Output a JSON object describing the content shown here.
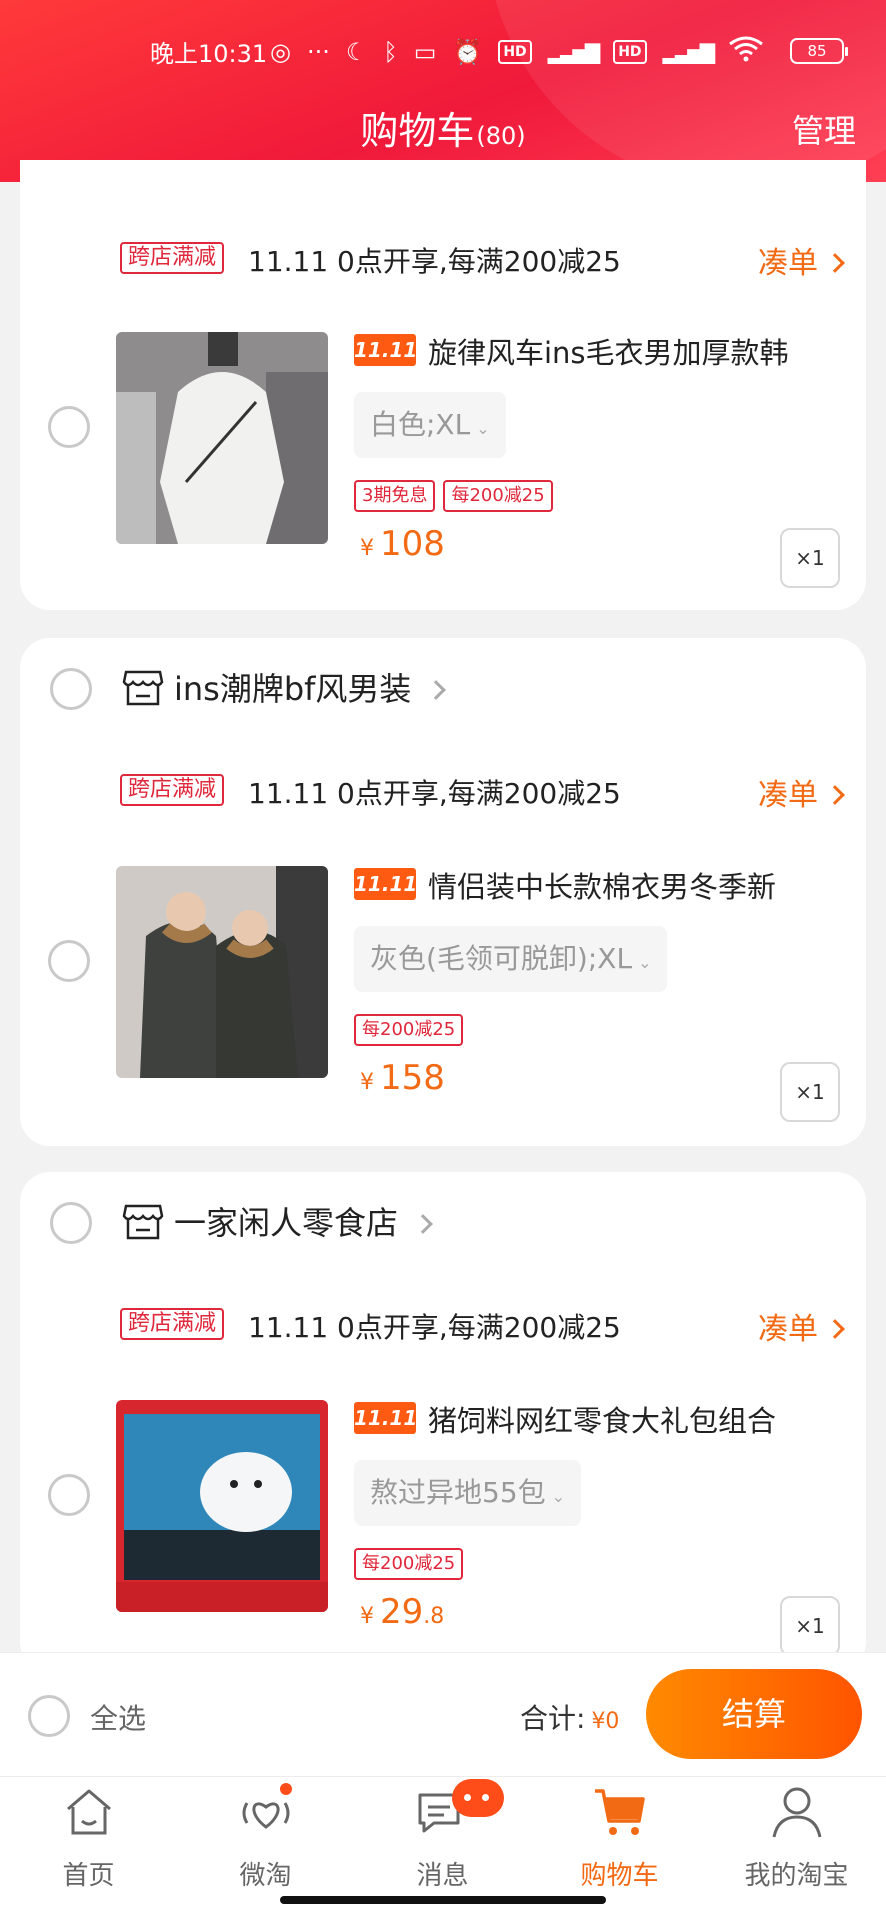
{
  "status_bar": {
    "time": "晚上10:31",
    "more": "···",
    "hd1": "HD",
    "hd2": "HD",
    "battery": "85"
  },
  "header": {
    "title": "购物车",
    "count": "(80)",
    "manage": "管理"
  },
  "shops": [
    {
      "name": "",
      "promo": {
        "tag": "跨店满减",
        "text": "11.11 0点开享,每满200减25",
        "link": "凑单"
      },
      "item": {
        "badge": "11.11",
        "name": "旋律风车ins毛衣男加厚款韩",
        "sku": "白色;XL",
        "tags": [
          "3期免息",
          "每200减25"
        ],
        "currency": "¥",
        "price": "108",
        "price_decimal": "",
        "qty": "×1"
      }
    },
    {
      "name": "ins潮牌bf风男装",
      "promo": {
        "tag": "跨店满减",
        "text": "11.11 0点开享,每满200减25",
        "link": "凑单"
      },
      "item": {
        "badge": "11.11",
        "name": "情侣装中长款棉衣男冬季新",
        "sku": "灰色(毛领可脱卸);XL",
        "tags": [
          "每200减25"
        ],
        "currency": "¥",
        "price": "158",
        "price_decimal": "",
        "qty": "×1"
      }
    },
    {
      "name": "一家闲人零食店",
      "promo": {
        "tag": "跨店满减",
        "text": "11.11 0点开享,每满200减25",
        "link": "凑单"
      },
      "item": {
        "badge": "11.11",
        "name": "猪饲料网红零食大礼包组合",
        "sku": "熬过异地55包",
        "tags": [
          "每200减25"
        ],
        "currency": "¥",
        "price": "29",
        "price_decimal": ".8",
        "qty": "×1"
      }
    }
  ],
  "checkout": {
    "select_all": "全选",
    "total_label": "合计:",
    "total_amount": "¥0",
    "settle": "结算"
  },
  "tabbar": [
    {
      "label": "首页",
      "icon": "home-icon"
    },
    {
      "label": "微淘",
      "icon": "weitao-icon"
    },
    {
      "label": "消息",
      "icon": "message-icon"
    },
    {
      "label": "购物车",
      "icon": "cart-icon"
    },
    {
      "label": "我的淘宝",
      "icon": "profile-icon"
    }
  ],
  "colors": {
    "accent": "#f26a14",
    "header": "#f0193a",
    "promo": "#e0283c"
  }
}
